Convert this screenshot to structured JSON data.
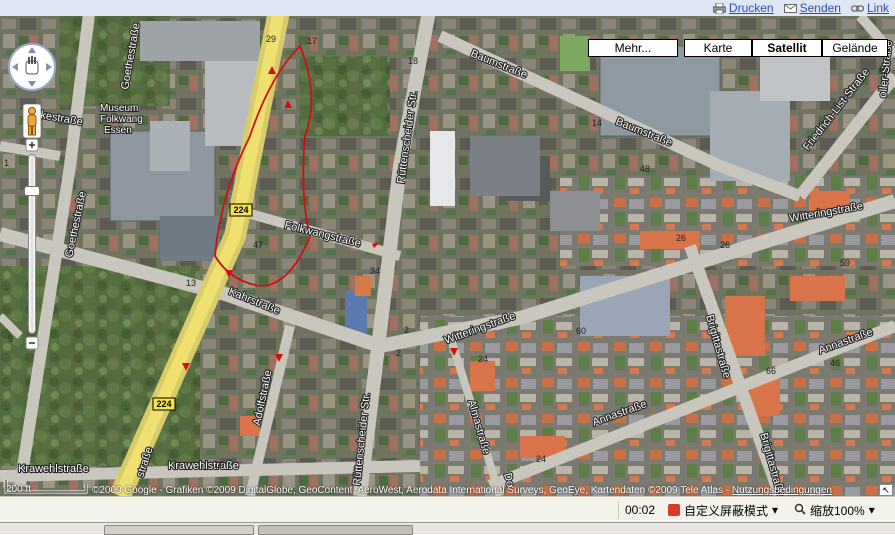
{
  "toplinks": {
    "print": "Drucken",
    "send": "Senden",
    "link": "Link"
  },
  "map_types": {
    "more": "Mehr...",
    "map": "Karte",
    "satellite": "Satellit",
    "terrain": "Gelände",
    "active": "Satellit"
  },
  "poi": {
    "museum_line1": "Museum",
    "museum_line2": "Folkwang",
    "museum_line3": "Essen"
  },
  "streets": {
    "goethestrasse_top": "Goethestraße",
    "goethestrasse_left": "Goethestraße",
    "bismarck": "kestraße",
    "baumstrasse_1": "Baumstraße",
    "baumstrasse_2": "Baumstraße",
    "friedrich_list": "Friedrich-List-Straße",
    "zoller": "oller-Straße",
    "ruttenscheider_1": "Rüttenscheider Str.",
    "ruttenscheider_2": "Rüttenscheider Str.",
    "folkwangstrasse": "Folkwangstraße",
    "witteringstrasse_1": "Witteringstraße",
    "witteringstrasse_2": "Witteringstraße",
    "kahrstrasse": "Kahrstraße",
    "adolfstrasse": "Adolfstraße",
    "almastrasse": "Almastraße",
    "brigittastrasse_1": "Brigittastraße",
    "brigittastrasse_2": "Brigittastraße",
    "annastrasse_1": "Annastraße",
    "annastrasse_2": "Annastraße",
    "krawehlstrasse_1": "Krawehlstraße",
    "krawehlstrasse_2": "Krawehlstraße",
    "strasse_bottom": "straße",
    "dor": "Do"
  },
  "route_shields": {
    "upper": "224",
    "lower": "224"
  },
  "house_numbers": [
    "29",
    "18",
    "14",
    "17",
    "26",
    "13",
    "34",
    "47",
    "2",
    "2",
    "46",
    "66",
    "24",
    "26",
    "10",
    "24",
    "60",
    "59",
    "9",
    "48",
    "8",
    "1"
  ],
  "scale": {
    "label": "200 ft"
  },
  "copyright": {
    "text": "©2009 Google - Grafiken ©2009 DigitalGlobe, GeoContent, AeroWest, Aerodata International Surveys, GeoEye, Kartendaten ©2009 Tele Atlas -",
    "terms": "Nutzungsbedingungen"
  },
  "statusbar": {
    "time": "00:02",
    "mode": "自定义屏蔽模式",
    "zoom": "缩放100%"
  },
  "colors": {
    "route": "#d01010",
    "main_road": "#e8d84a",
    "roof_orange": "#d9744a"
  }
}
